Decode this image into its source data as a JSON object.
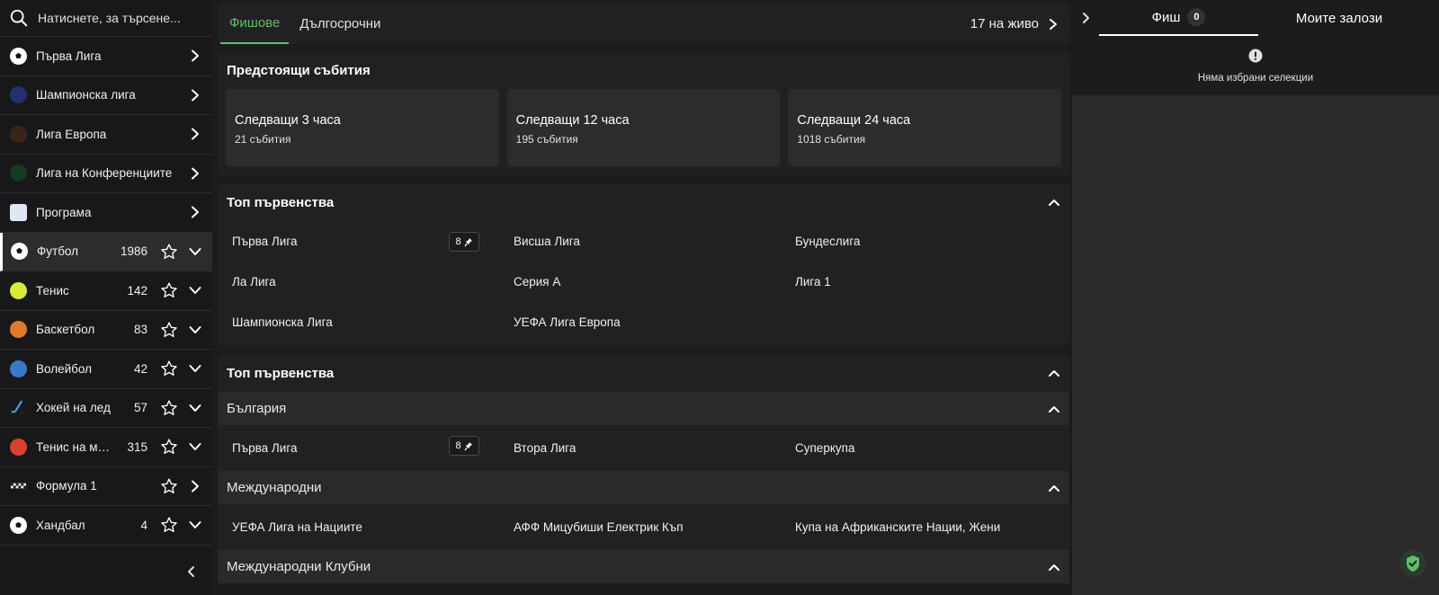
{
  "search": {
    "placeholder": "Натиснете, за търсене..."
  },
  "sidebar": {
    "items": [
      {
        "label": "Първа Лига",
        "count": "",
        "icon": "soccer-ball-icon",
        "star": false,
        "chevron": "right"
      },
      {
        "label": "Шампионска лига",
        "count": "",
        "icon": "trophy-icon",
        "star": false,
        "chevron": "right"
      },
      {
        "label": "Лига Европа",
        "count": "",
        "icon": "cup-icon",
        "star": false,
        "chevron": "right"
      },
      {
        "label": "Лига на Конференциите",
        "count": "",
        "icon": "conference-cup-icon",
        "star": false,
        "chevron": "right"
      },
      {
        "label": "Програма",
        "count": "",
        "icon": "calendar-icon",
        "star": false,
        "chevron": "right"
      },
      {
        "label": "Футбол",
        "count": "1986",
        "icon": "soccer-ball-icon",
        "star": true,
        "chevron": "down",
        "active": true
      },
      {
        "label": "Тенис",
        "count": "142",
        "icon": "tennis-ball-icon",
        "star": true,
        "chevron": "down"
      },
      {
        "label": "Баскетбол",
        "count": "83",
        "icon": "basketball-icon",
        "star": true,
        "chevron": "down"
      },
      {
        "label": "Волейбол",
        "count": "42",
        "icon": "volleyball-icon",
        "star": true,
        "chevron": "down"
      },
      {
        "label": "Хокей на лед",
        "count": "57",
        "icon": "hockey-icon",
        "star": true,
        "chevron": "down"
      },
      {
        "label": "Тенис на маса",
        "count": "315",
        "icon": "ping-pong-icon",
        "star": true,
        "chevron": "down"
      },
      {
        "label": "Формула 1",
        "count": "",
        "icon": "racing-flag-icon",
        "star": true,
        "chevron": "right"
      },
      {
        "label": "Хандбал",
        "count": "4",
        "icon": "handball-icon",
        "star": true,
        "chevron": "down"
      }
    ]
  },
  "main": {
    "tabs": [
      {
        "label": "Фишове",
        "active": true
      },
      {
        "label": "Дългосрочни",
        "active": false
      }
    ],
    "live_label": "17 на живо",
    "upcoming": {
      "title": "Предстоящи събития",
      "cards": [
        {
          "title": "Следващи 3 часа",
          "sub": "21 събития"
        },
        {
          "title": "Следващи 12 часа",
          "sub": "195 събития"
        },
        {
          "title": "Следващи 24 часа",
          "sub": "1018 събития"
        }
      ]
    },
    "top1": {
      "title": "Топ първенства",
      "items": [
        "Първа Лига",
        "Висша Лига",
        "Бундеслига",
        "Ла Лига",
        "Серия А",
        "Лига 1",
        "Шампионска Лига",
        "УЕФА Лига Европа",
        ""
      ],
      "badge": "8"
    },
    "top2": {
      "title": "Топ първенства",
      "groups": [
        {
          "name": "България",
          "items": [
            "Първа Лига",
            "Втора Лига",
            "Суперкупа"
          ],
          "badge": "8"
        },
        {
          "name": "Международни",
          "items": [
            "УЕФА Лига на Нациите",
            "АФФ Мицубиши Електрик Къп",
            "Купа на Африканските Нации, Жени"
          ]
        },
        {
          "name": "Международни Клубни",
          "items": []
        }
      ]
    }
  },
  "betslip": {
    "tab_slip": "Фиш",
    "slip_count": "0",
    "tab_mybets": "Моите залози",
    "empty_msg": "Няма избрани селекции"
  },
  "colors": {
    "accent_green": "#5fbf6a",
    "bg": "#1c1c1e",
    "panel": "#212124"
  }
}
